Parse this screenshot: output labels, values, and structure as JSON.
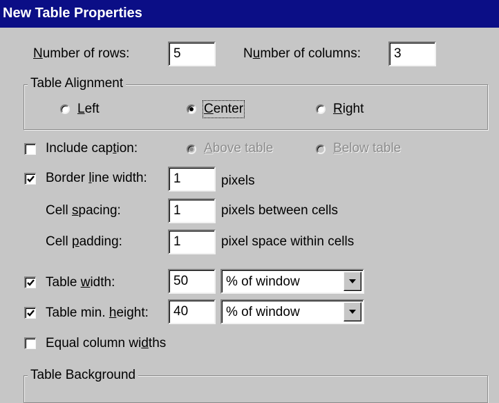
{
  "dialog": {
    "title": "New Table Properties"
  },
  "rows_cols": {
    "rows_label_pre": "",
    "rows_label_accel": "N",
    "rows_label_post": "umber of rows:",
    "rows_value": "5",
    "cols_label_pre": "N",
    "cols_label_accel": "u",
    "cols_label_post": "mber of columns:",
    "cols_value": "3"
  },
  "alignment": {
    "group_label": "Table Alignment",
    "options": [
      {
        "accel": "L",
        "rest": "eft",
        "selected": false
      },
      {
        "accel": "C",
        "rest": "enter",
        "selected": true
      },
      {
        "accel": "R",
        "rest": "ight",
        "selected": false
      }
    ]
  },
  "caption": {
    "label_pre": "Include cap",
    "label_accel": "t",
    "label_post": "ion:",
    "checked": false,
    "above_accel": "A",
    "above_rest": "bove table",
    "below_accel": "B",
    "below_rest": "elow table"
  },
  "border": {
    "label_pre": "Border ",
    "label_accel": "l",
    "label_post": "ine width:",
    "checked": true,
    "value": "1",
    "unit": "pixels"
  },
  "spacing": {
    "label_pre": "Cell ",
    "label_accel": "s",
    "label_post": "pacing:",
    "value": "1",
    "unit": "pixels between cells"
  },
  "padding": {
    "label_pre": "Cell ",
    "label_accel": "p",
    "label_post": "adding:",
    "value": "1",
    "unit": "pixel space within cells"
  },
  "width": {
    "label_pre": "Table ",
    "label_accel": "w",
    "label_post": "idth:",
    "checked": true,
    "value": "50",
    "unit": "% of window"
  },
  "height": {
    "label_pre": "Table min. ",
    "label_accel": "h",
    "label_post": "eight:",
    "checked": true,
    "value": "40",
    "unit": "% of window"
  },
  "equal_cols": {
    "label_pre": "Equal column wi",
    "label_accel": "d",
    "label_post": "ths",
    "checked": false
  },
  "background": {
    "group_label": "Table Background"
  },
  "colors": {
    "title_bg": "#0b0e86",
    "dialog_bg": "#c6c6c6",
    "disabled_text": "#8c8c8c"
  }
}
